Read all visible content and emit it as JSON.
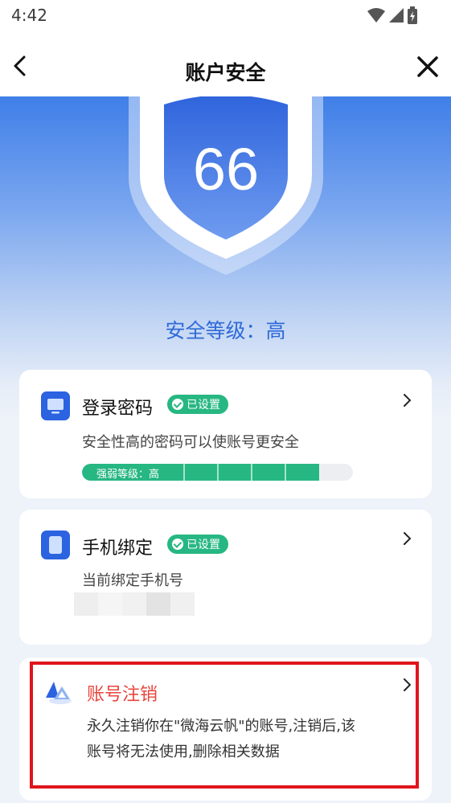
{
  "status_bar": {
    "time": "4:42"
  },
  "header": {
    "title": "账户安全"
  },
  "hero": {
    "score": "66",
    "level_text": "安全等级：高"
  },
  "cards": {
    "password": {
      "title": "登录密码",
      "badge": "已设置",
      "description": "安全性高的密码可以使账号更安全",
      "strength_label": "强弱等级：高",
      "strength_fraction": 0.875
    },
    "phone": {
      "title": "手机绑定",
      "badge": "已设置",
      "description": "当前绑定手机号"
    },
    "cancel": {
      "title": "账号注销",
      "description_line1": "永久注销你在\"微海云帆\"的账号,注销后,该",
      "description_line2": "账号将无法使用,删除相关数据"
    }
  },
  "colors": {
    "accent": "#2b63e0",
    "success": "#27b782",
    "danger": "#e8453c",
    "highlight": "#e0151b"
  }
}
